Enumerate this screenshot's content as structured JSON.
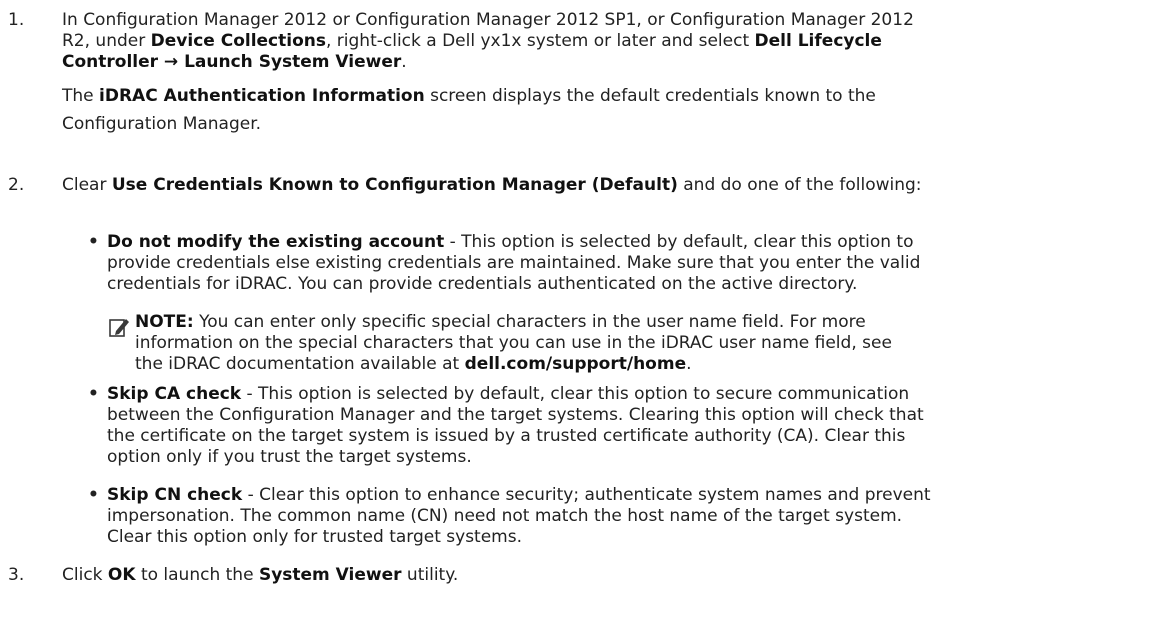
{
  "steps": [
    {
      "number": "1.",
      "lines": [
        [
          "In Configuration Manager 2012 or Configuration Manager 2012 SP1, or Configuration Manager 2012"
        ],
        [
          "R2, under ",
          "Device Collections",
          ", right-click a Dell yx1x system or later and select ",
          "Dell Lifecycle"
        ],
        [
          "Controller → Launch System Viewer",
          "."
        ]
      ],
      "follow": {
        "lines": [
          [
            "The ",
            "iDRAC Authentication Information",
            " screen displays the default credentials known to the"
          ],
          [
            "Configuration Manager."
          ]
        ]
      }
    },
    {
      "number": "2.",
      "lines": [
        [
          "Clear ",
          "Use Credentials Known to Configuration Manager (Default)",
          " and do one of the following:"
        ]
      ],
      "bullets": [
        {
          "term": "Do not modify the existing account",
          "lines": [
            " - This option is selected by default, clear this option to",
            "provide credentials else existing credentials are maintained. Make sure that you enter the valid",
            "credentials for iDRAC. You can provide credentials authenticated on the active directory."
          ]
        },
        {
          "term": "Skip CA check",
          "lines": [
            " - This option is selected by default, clear this option to secure communication",
            "between the Configuration Manager and the target systems. Clearing this option will check that",
            "the certificate on the target system is issued by a trusted certificate authority (CA). Clear this",
            "option only if you trust the target systems."
          ]
        },
        {
          "term": "Skip CN check",
          "lines": [
            " - Clear this option to enhance security; authenticate system names and prevent",
            "impersonation. The common name (CN) need not match the host name of the target system.",
            "Clear this option only for trusted target systems."
          ]
        }
      ],
      "note": {
        "label": "NOTE:",
        "line1": " You can enter only specific special characters in the user name field. For more",
        "line2": "information on the special characters that you can use in the iDRAC user name field, see",
        "line3_pre": "the iDRAC documentation available at ",
        "link": "dell.com/support/home",
        "line3_post": "."
      }
    },
    {
      "number": "3.",
      "parts": [
        "Click ",
        "OK",
        " to launch the ",
        "System Viewer",
        " utility."
      ]
    }
  ],
  "icons": {
    "note_icon": "pencil-note-icon"
  },
  "colors": {
    "text": "#222222",
    "icon": "#3a3a3a"
  }
}
